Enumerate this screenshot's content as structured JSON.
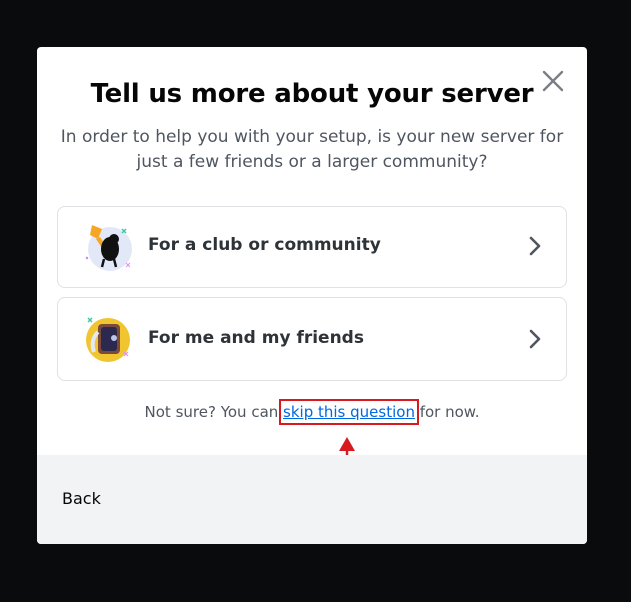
{
  "modal": {
    "title": "Tell us more about your server",
    "subtitle": "In order to help you with your setup, is your new server for just a few friends or a larger community?",
    "close_icon": "close-icon"
  },
  "options": [
    {
      "label": "For a club or community",
      "icon": "club-illustration-icon",
      "chevron": "chevron-right-icon"
    },
    {
      "label": "For me and my friends",
      "icon": "friends-illustration-icon",
      "chevron": "chevron-right-icon"
    }
  ],
  "skip": {
    "prefix": "Not sure? You can ",
    "link_text": "skip this question",
    "suffix": " for now."
  },
  "annotation": {
    "highlight_color": "#d71920"
  },
  "footer": {
    "back_label": "Back"
  },
  "colors": {
    "link": "#0068e0",
    "footer_bg": "#f2f3f5",
    "backdrop": "#0a0b0d"
  }
}
